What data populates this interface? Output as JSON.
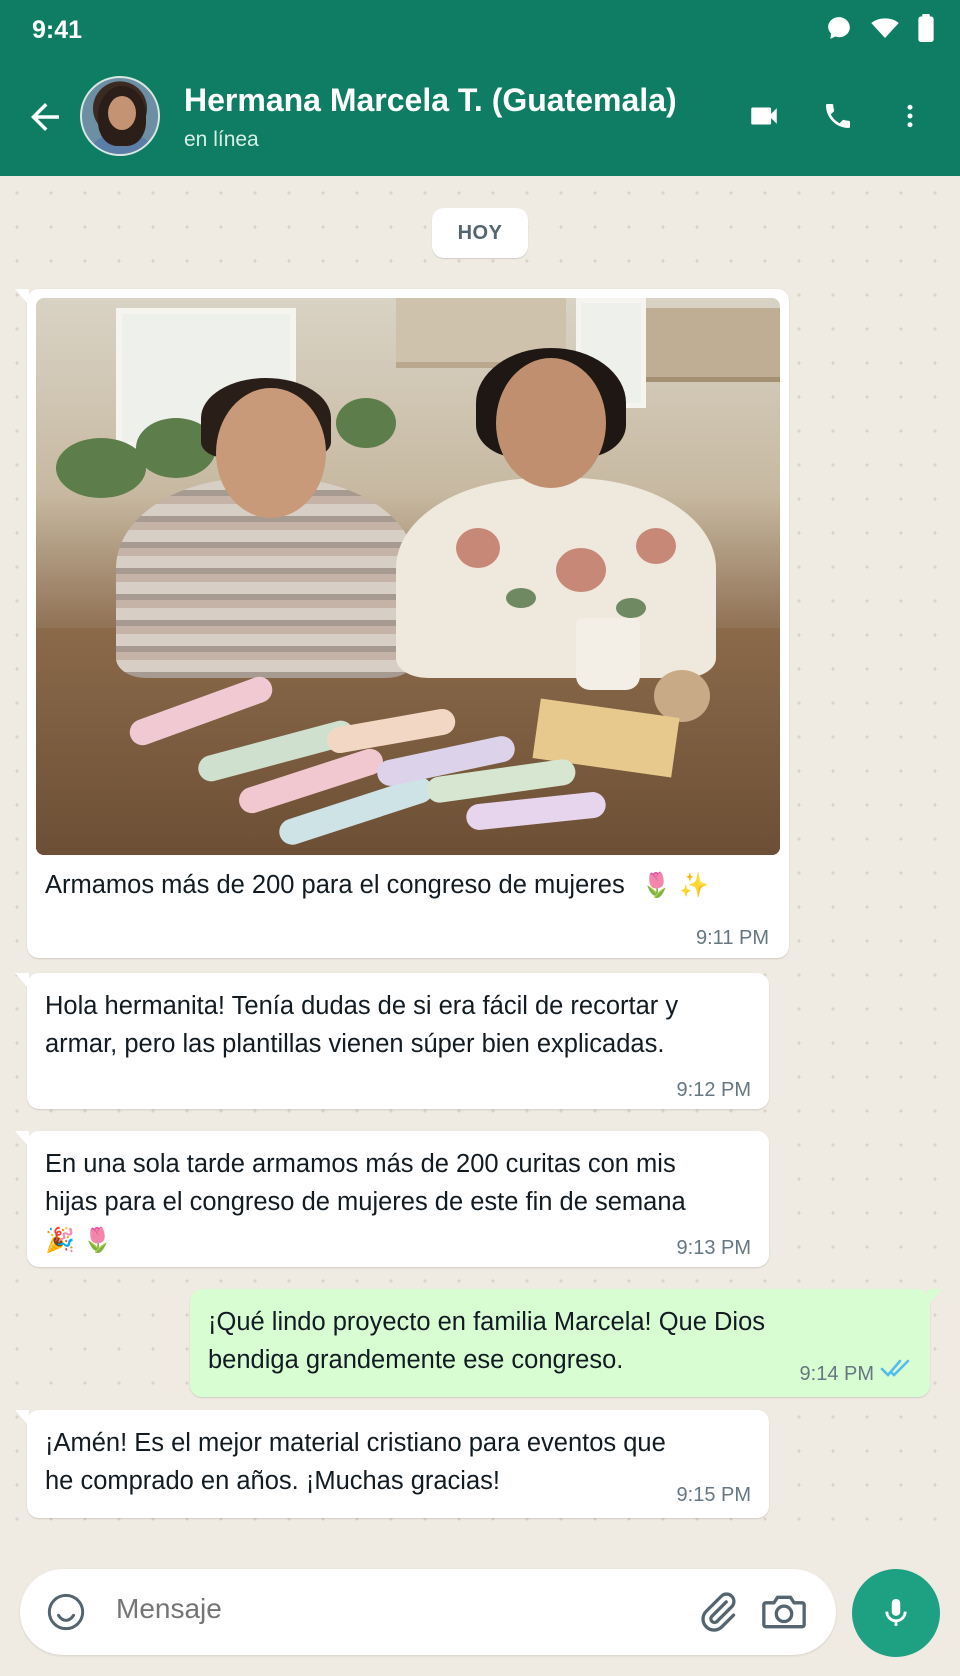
{
  "status_bar": {
    "time": "9:41"
  },
  "header": {
    "contact_name": "Hermana Marcela T. (Guatemala)",
    "contact_status": "en línea",
    "icons": [
      "back-arrow-icon",
      "video-call-icon",
      "phone-icon",
      "more-vert-icon"
    ]
  },
  "chat": {
    "day_label": "HOY",
    "messages": [
      {
        "direction": "in",
        "kind": "image",
        "caption": "Armamos más de 200 para el congreso de mujeres",
        "emoji": "🌷 ✨",
        "time": "9:11 PM"
      },
      {
        "direction": "in",
        "text_line1": "Hola hermanita! Tenía dudas de si era fácil de recortar y",
        "text_line2": "armar, pero las plantillas vienen súper bien explicadas.",
        "time": "9:12 PM"
      },
      {
        "direction": "in",
        "text_line1": "En una sola tarde armamos más de 200 curitas con mis",
        "text_line2": "hijas para el congreso de mujeres de este fin de semana",
        "emoji": "🎉 🌷",
        "time": "9:13 PM"
      },
      {
        "direction": "out",
        "text_line1": "¡Qué lindo proyecto en familia Marcela! Que Dios",
        "text_line2": "bendiga grandemente ese congreso.",
        "time": "9:14 PM",
        "read_receipt": "double-check-icon"
      },
      {
        "direction": "in",
        "text_line1": "¡Amén! Es el mejor material cristiano para eventos que",
        "text_line2": "he comprado en años. ¡Muchas gracias!",
        "time": "9:15 PM"
      }
    ]
  },
  "composer": {
    "placeholder": "Mensaje"
  },
  "colors": {
    "header": "#0f7d63",
    "outgoing_bubble": "#d9fdd3",
    "mic_button": "#1ea083",
    "read_receipt": "#53bdeb"
  }
}
